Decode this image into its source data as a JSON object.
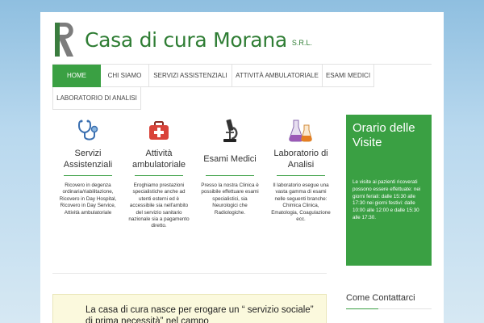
{
  "brand": {
    "name": "Casa di cura Morana",
    "suffix": "S.R.L.",
    "color": "#2f7d34"
  },
  "nav": {
    "items": [
      {
        "label": "HOME",
        "active": true
      },
      {
        "label": "CHI SIAMO"
      },
      {
        "label": "SERVIZI ASSISTENZIALI"
      },
      {
        "label": "ATTIVITÀ AMBULATORIALE"
      },
      {
        "label": "ESAMI MEDICI"
      },
      {
        "label": "LABORATORIO DI ANALISI"
      }
    ]
  },
  "services": [
    {
      "icon": "stethoscope-icon",
      "title": "Servizi Assistenziali",
      "desc": "Ricovero in degenza ordinaria/riabilitazione, Ricovero in Day Hospital, Ricovero in Day Service, Attività ambulatoriale"
    },
    {
      "icon": "first-aid-kit-icon",
      "title": "Attività ambulatoriale",
      "desc": "Eroghiamo prestazioni specialistiche anche ad utenti esterni ed è accessibile sia nell'ambito del servizio sanitario nazionale sia a pagamento diretto."
    },
    {
      "icon": "microscope-icon",
      "title": "Esami Medici",
      "desc": "Presso la nostra Clinica è possibile effettuare esami specialistici, sia Neurologici che Radiologiche."
    },
    {
      "icon": "flasks-icon",
      "title": "Laboratorio di Analisi",
      "desc": "Il laboratorio esegue una vasta gamma di esami nelle seguenti branche: Chimica Clinica, Ematologia, Coagulazione ecc."
    }
  ],
  "notice": {
    "text": "La casa di cura nasce per erogare un “ servizio sociale” di prima necessità” nel campo"
  },
  "sidebar": {
    "visits_title": "Orario delle Visite",
    "visits_text": "Le visite ai pazienti ricoverati possono essere effettuate: nei giorni feriali: dalle 15:30 alle 17:30 nei giorni festivi: dalle 10:00 alle 12:00 e dalle 15:30 alle 17:30.",
    "contact_title": "Come Contattarci",
    "accent": "#3aa043"
  }
}
